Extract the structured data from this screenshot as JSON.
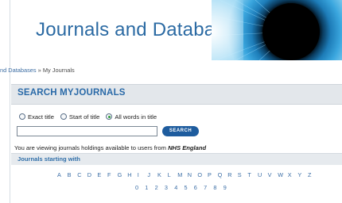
{
  "header": {
    "title": "Journals and Databases"
  },
  "breadcrumb": {
    "parent": "nd Databases",
    "separator": "»",
    "current": "My Journals"
  },
  "search_section": {
    "heading": "SEARCH MYJOURNALS",
    "options": [
      {
        "label": "Exact title",
        "checked": false
      },
      {
        "label": "Start of title",
        "checked": false
      },
      {
        "label": "All words in title",
        "checked": true
      }
    ],
    "input_value": "",
    "button_label": "SEARCH"
  },
  "viewing": {
    "text": "You are viewing journals holdings available to users from",
    "organisation": "NHS England"
  },
  "browse": {
    "heading": "Journals starting with",
    "letters": [
      "A",
      "B",
      "C",
      "D",
      "E",
      "F",
      "G",
      "H",
      "I",
      "J",
      "K",
      "L",
      "M",
      "N",
      "O",
      "P",
      "Q",
      "R",
      "S",
      "T",
      "U",
      "V",
      "W",
      "X",
      "Y",
      "Z"
    ],
    "digits": [
      "0",
      "1",
      "2",
      "3",
      "4",
      "5",
      "6",
      "7",
      "8",
      "9"
    ]
  },
  "colors": {
    "title": "#2b6aa3",
    "section_heading": "#2a6aa8",
    "button": "#1e5c9e",
    "links": "#3b6ea6"
  }
}
